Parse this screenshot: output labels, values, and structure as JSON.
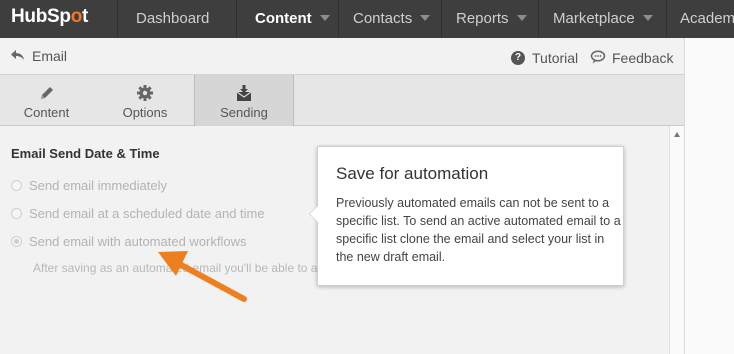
{
  "nav": {
    "logo_text": "HubSp",
    "logo_sprocket": "o",
    "logo_tail": "t",
    "items": [
      {
        "label": "Dashboard",
        "active": false,
        "dropdown": false
      },
      {
        "label": "Content",
        "active": true,
        "dropdown": true
      },
      {
        "label": "Contacts",
        "active": false,
        "dropdown": true
      },
      {
        "label": "Reports",
        "active": false,
        "dropdown": true
      },
      {
        "label": "Marketplace",
        "active": false,
        "dropdown": true
      },
      {
        "label": "Academ",
        "active": false,
        "dropdown": false
      }
    ]
  },
  "header": {
    "back_label": "Email",
    "back_icon": "back-arrow-icon",
    "tutorial_label": "Tutorial",
    "tutorial_icon": "question-circle-icon",
    "feedback_label": "Feedback",
    "feedback_icon": "speech-bubble-icon"
  },
  "tabs": [
    {
      "label": "Content",
      "icon": "pencil-icon",
      "selected": false
    },
    {
      "label": "Options",
      "icon": "gear-icon",
      "selected": false
    },
    {
      "label": "Sending",
      "icon": "envelope-download-icon",
      "selected": true
    }
  ],
  "main": {
    "section_title": "Email Send Date & Time",
    "options": [
      {
        "label": "Send email immediately",
        "checked": false,
        "disabled": true
      },
      {
        "label": "Send email at a scheduled date and time",
        "checked": false,
        "disabled": true
      },
      {
        "label": "Send email with automated workflows",
        "checked": true,
        "disabled": true
      }
    ],
    "subtext": "After saving as an automated email you'll be able to add it to automated workflows."
  },
  "popover": {
    "title": "Save for automation",
    "body": "Previously automated emails can not be sent to a specific list. To send an active automated email to a specific list clone the email and select your list in the new draft email."
  },
  "colors": {
    "nav_bg": "#3e3e3e",
    "accent": "#f57722",
    "annotation_arrow": "#ee7f1f"
  }
}
